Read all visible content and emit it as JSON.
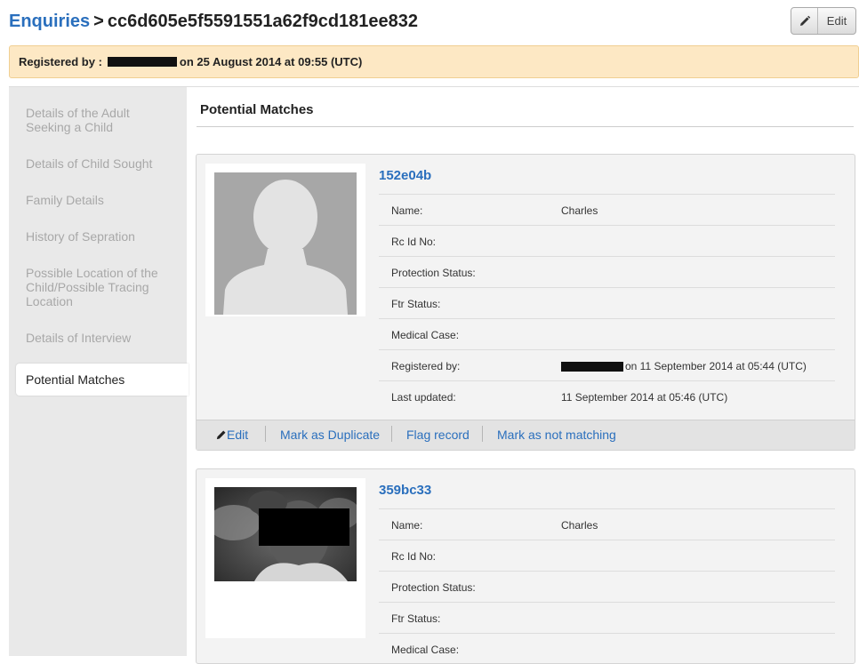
{
  "header": {
    "breadcrumb_link": "Enquiries",
    "breadcrumb_sep": ">",
    "record_id": "cc6d605e5f5591551a62f9cd181ee832",
    "edit_label": "Edit"
  },
  "registration": {
    "label": "Registered by :",
    "suffix": "on 25 August 2014 at 09:55 (UTC)"
  },
  "sidebar": {
    "items": [
      {
        "label": "Details of the Adult Seeking a Child"
      },
      {
        "label": "Details of Child Sought"
      },
      {
        "label": "Family Details"
      },
      {
        "label": "History of Sepration"
      },
      {
        "label": "Possible Location of the Child/Possible Tracing Location"
      },
      {
        "label": "Details of Interview"
      },
      {
        "label": "Potential Matches"
      }
    ],
    "active": "Potential Matches"
  },
  "main": {
    "title": "Potential Matches",
    "matches": [
      {
        "id": "152e04b",
        "fields": [
          {
            "label": "Name:",
            "value": "Charles"
          },
          {
            "label": "Rc Id No:",
            "value": ""
          },
          {
            "label": "Protection Status:",
            "value": ""
          },
          {
            "label": "Ftr Status:",
            "value": ""
          },
          {
            "label": "Medical Case:",
            "value": ""
          },
          {
            "label": "Registered by:",
            "value": "on 11 September 2014 at 05:44 (UTC)"
          },
          {
            "label": "Last updated:",
            "value": "11 September 2014 at 05:46 (UTC)"
          }
        ],
        "actions": {
          "edit": "Edit",
          "duplicate": "Mark as Duplicate",
          "flag": "Flag record",
          "not_matching": "Mark as not matching"
        }
      },
      {
        "id": "359bc33",
        "fields": [
          {
            "label": "Name:",
            "value": "Charles"
          },
          {
            "label": "Rc Id No:",
            "value": ""
          },
          {
            "label": "Protection Status:",
            "value": ""
          },
          {
            "label": "Ftr Status:",
            "value": ""
          },
          {
            "label": "Medical Case:",
            "value": ""
          }
        ]
      }
    ]
  },
  "colors": {
    "link": "#2a6fbd",
    "banner_bg": "#fde8c4",
    "sidebar_bg": "#e9e9e9",
    "card_bg": "#f3f3f3"
  },
  "icons": [
    "pencil-icon",
    "avatar-placeholder-icon"
  ]
}
